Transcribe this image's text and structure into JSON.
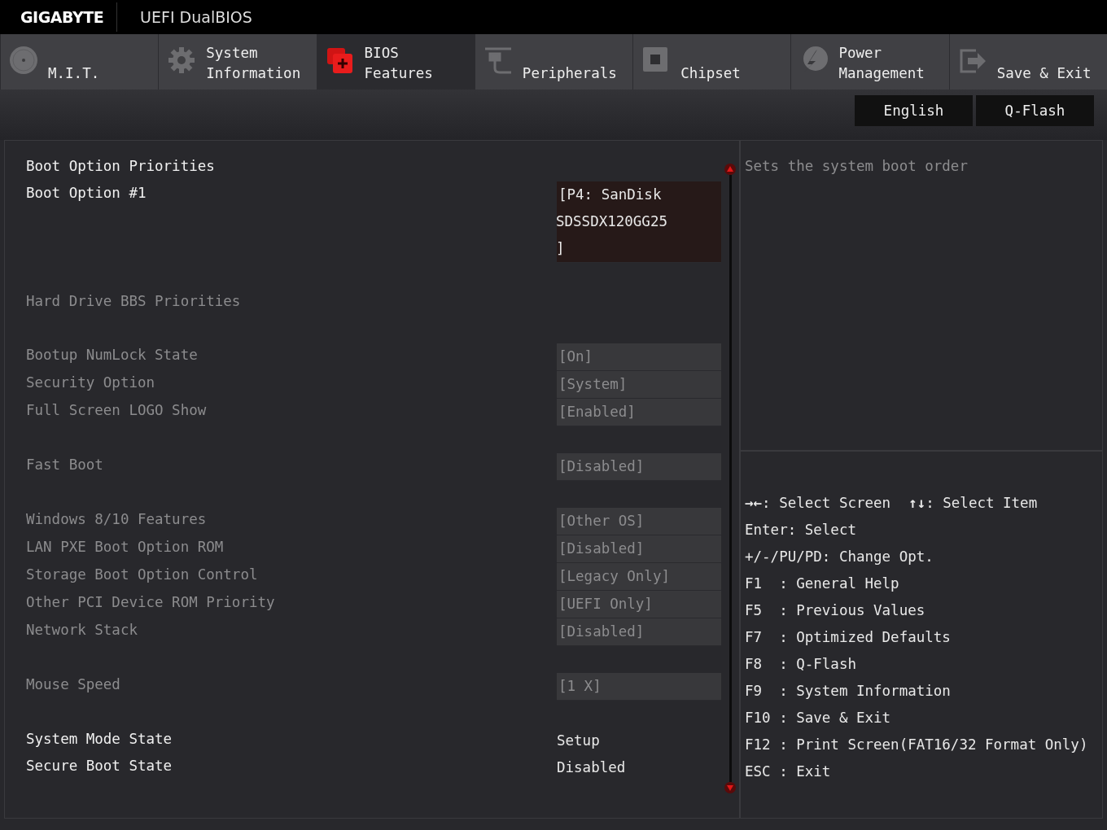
{
  "header": {
    "brand": "GIGABYTE",
    "title": "UEFI DualBIOS"
  },
  "tabs": [
    {
      "label": "M.I.T.",
      "kind": "disc",
      "selected": false
    },
    {
      "label": "System\nInformation",
      "kind": "gear",
      "selected": false
    },
    {
      "label": "BIOS\nFeatures",
      "kind": "chip",
      "selected": true
    },
    {
      "label": "Peripherals",
      "kind": "plug",
      "selected": false
    },
    {
      "label": "Chipset",
      "kind": "square",
      "selected": false
    },
    {
      "label": "Power\nManagement",
      "kind": "bolt",
      "selected": false
    },
    {
      "label": "Save & Exit",
      "kind": "exit",
      "selected": false
    }
  ],
  "toolbar_buttons": [
    "English",
    "Q-Flash"
  ],
  "groups": [
    [
      {
        "kind": "header",
        "label": "Boot Option Priorities",
        "disabled": false
      },
      {
        "kind": "setting",
        "label": "Boot Option #1",
        "value": [
          "[P4: SanDisk",
          "SDSSDX120GG25",
          "]"
        ],
        "disabled": false,
        "selected": true
      }
    ],
    [
      {
        "kind": "header",
        "label": "Hard Drive BBS Priorities",
        "disabled": true
      }
    ],
    [
      {
        "kind": "setting",
        "label": "Bootup NumLock State",
        "value": [
          "[On]"
        ],
        "disabled": true,
        "selected": false
      },
      {
        "kind": "setting",
        "label": "Security Option",
        "value": [
          "[System]"
        ],
        "disabled": true,
        "selected": false
      },
      {
        "kind": "setting",
        "label": "Full Screen LOGO Show",
        "value": [
          "[Enabled]"
        ],
        "disabled": true,
        "selected": false
      }
    ],
    [
      {
        "kind": "setting",
        "label": "Fast Boot",
        "value": [
          "[Disabled]"
        ],
        "disabled": true,
        "selected": false
      }
    ],
    [
      {
        "kind": "setting",
        "label": "Windows 8/10 Features",
        "value": [
          "[Other OS]"
        ],
        "disabled": true,
        "selected": false
      },
      {
        "kind": "setting",
        "label": "LAN PXE Boot Option ROM",
        "value": [
          "[Disabled]"
        ],
        "disabled": true,
        "selected": false
      },
      {
        "kind": "setting",
        "label": "Storage Boot Option Control",
        "value": [
          "[Legacy Only]"
        ],
        "disabled": true,
        "selected": false
      },
      {
        "kind": "setting",
        "label": "Other PCI Device ROM Priority",
        "value": [
          "[UEFI Only]"
        ],
        "disabled": true,
        "selected": false
      },
      {
        "kind": "setting",
        "label": "Network Stack",
        "value": [
          "[Disabled]"
        ],
        "disabled": true,
        "selected": false
      }
    ],
    [
      {
        "kind": "setting",
        "label": "Mouse Speed",
        "value": [
          "[1 X]"
        ],
        "disabled": true,
        "selected": false
      }
    ],
    [
      {
        "kind": "info",
        "label": "System Mode State",
        "value": [
          "Setup"
        ],
        "disabled": false
      },
      {
        "kind": "info",
        "label": "Secure Boot State",
        "value": [
          "Disabled"
        ],
        "disabled": false
      }
    ]
  ],
  "help": {
    "description": "Sets the system boot order",
    "navigation": [
      {
        "keys": "→←",
        "text": ": Select Screen"
      },
      {
        "keys": "↑↓",
        "text": ": Select Item"
      }
    ],
    "keys": [
      "Enter: Select",
      "+/-/PU/PD: Change Opt.",
      "F1  : General Help",
      "F5  : Previous Values",
      "F7  : Optimized Defaults",
      "F8  : Q-Flash",
      "F9  : System Information",
      "F10 : Save & Exit",
      "F12 : Print Screen(FAT16/32 Format Only)",
      "ESC : Exit"
    ]
  }
}
